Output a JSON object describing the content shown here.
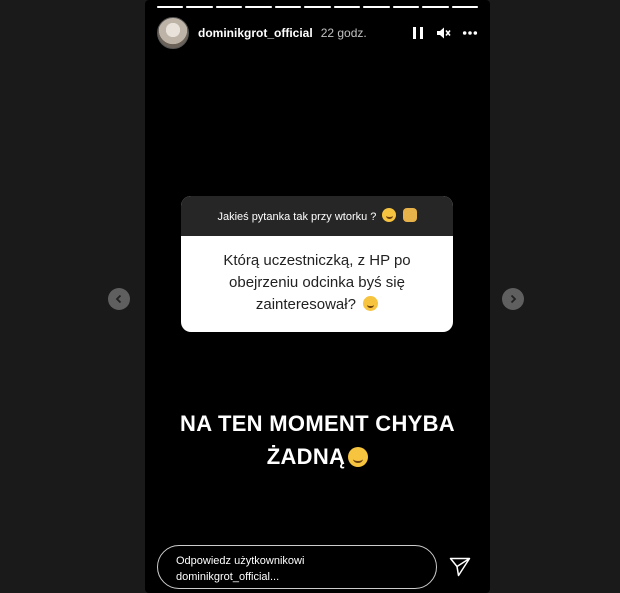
{
  "story": {
    "progress": [
      1,
      1,
      1,
      1,
      1,
      1,
      1,
      1,
      1,
      1,
      1
    ],
    "username": "dominikgrot_official",
    "timestamp": "22 godz.",
    "controls": {
      "pause_icon": "pause-icon",
      "mute_icon": "speaker-muted-icon",
      "more_icon": "more-horizontal-icon"
    }
  },
  "question_box": {
    "header": "Jakieś pytanka tak przy wtorku ?",
    "header_emojis": [
      "smiling-face-emoji",
      "fist-emoji"
    ],
    "question": "Którą uczestniczką, z HP po obejrzeniu odcinka byś się zainteresował?",
    "question_emoji": "smirking-face-emoji"
  },
  "answer": {
    "line1": "NA TEN MOMENT CHYBA",
    "line2": "ŻADNĄ",
    "emoji": "grinning-sweat-emoji"
  },
  "reply": {
    "placeholder_line1": "Odpowiedz użytkownikowi",
    "placeholder_line2": "dominikgrot_official...",
    "send_icon": "send-icon"
  },
  "navigation": {
    "prev_icon": "chevron-left-icon",
    "next_icon": "chevron-right-icon"
  },
  "colors": {
    "story_background": "#000000",
    "page_background": "#1a1a1a",
    "question_header_bg": "#262626",
    "question_body_bg": "#ffffff"
  }
}
